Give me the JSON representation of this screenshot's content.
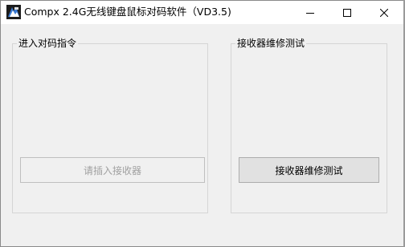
{
  "window": {
    "title": "Compx 2.4G无线键盘鼠标对码软件（VD3.5)",
    "app_icon": "app-logo-icon",
    "controls": {
      "minimize_icon": "minimize-icon",
      "maximize_icon": "maximize-icon",
      "close_icon": "close-icon"
    }
  },
  "pairing_group": {
    "label": "进入对码指令",
    "button_label": "请插入接收器",
    "button_enabled": false
  },
  "repair_group": {
    "label": "接收器维修测试",
    "button_label": "接收器维修测试",
    "button_enabled": true
  },
  "colors": {
    "background": "#f0f0f0",
    "titlebar": "#ffffff",
    "disabled_text": "#a0a0a0"
  }
}
